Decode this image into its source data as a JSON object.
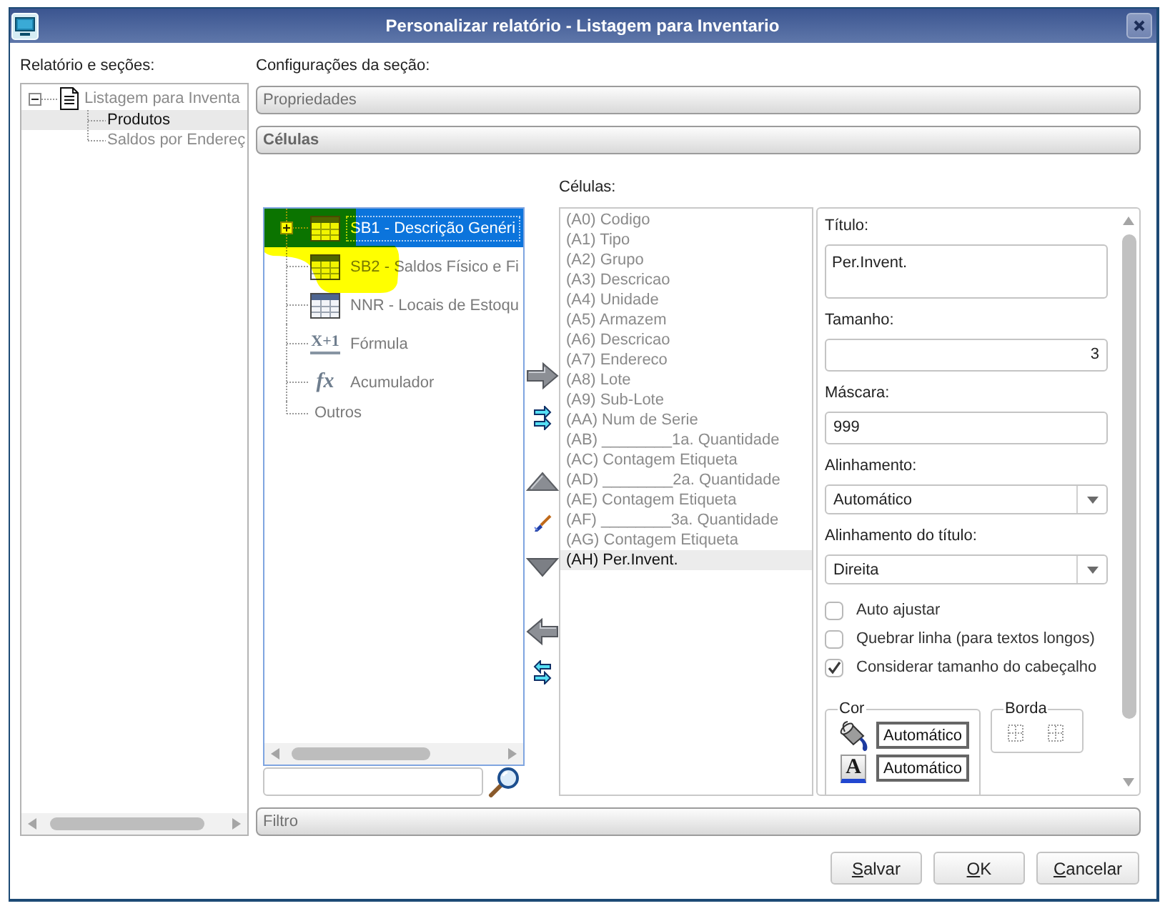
{
  "window": {
    "title": "Personalizar relatório - Listagem para Inventario"
  },
  "report_tree": {
    "label": "Relatório e seções:",
    "items": [
      {
        "label": "Listagem para Inventa",
        "kind": "document",
        "expanded": true,
        "selected": false,
        "children": [
          {
            "label": "Produtos",
            "selected": true
          },
          {
            "label": "Saldos por Endereç",
            "selected": false
          }
        ]
      }
    ]
  },
  "section": {
    "label": "Configurações da seção:",
    "panels": [
      {
        "label": "Propriedades",
        "expanded": false
      },
      {
        "label": "Células",
        "expanded": true,
        "editor": {
          "sources": [
            {
              "label": "SB1 - Descrição Genéri",
              "kind": "table",
              "collapsed": true,
              "selected": true
            },
            {
              "label": "SB2 - Saldos Físico e Fi",
              "kind": "table",
              "selected": false
            },
            {
              "label": "NNR - Locais de Estoqu",
              "kind": "table",
              "selected": false
            },
            {
              "label": "Fórmula",
              "kind": "formula",
              "glyph": "X+1",
              "selected": false
            },
            {
              "label": "Acumulador",
              "kind": "accumulator",
              "glyph": "fx",
              "selected": false
            },
            {
              "label": "Outros",
              "kind": "group",
              "selected": false
            }
          ],
          "cells": {
            "label": "Células:",
            "items": [
              {
                "label": "(A0) Codigo",
                "selected": false
              },
              {
                "label": "(A1) Tipo",
                "selected": false
              },
              {
                "label": "(A2) Grupo",
                "selected": false
              },
              {
                "label": "(A3) Descricao",
                "selected": false
              },
              {
                "label": "(A4) Unidade",
                "selected": false
              },
              {
                "label": "(A5) Armazem",
                "selected": false
              },
              {
                "label": "(A6) Descricao",
                "selected": false
              },
              {
                "label": "(A7) Endereco",
                "selected": false
              },
              {
                "label": "(A8) Lote",
                "selected": false
              },
              {
                "label": "(A9) Sub-Lote",
                "selected": false
              },
              {
                "label": "(AA) Num de Serie",
                "selected": false
              },
              {
                "label": "(AB) ________1a. Quantidade",
                "selected": false
              },
              {
                "label": "(AC) Contagem Etiqueta",
                "selected": false
              },
              {
                "label": "(AD) ________2a. Quantidade",
                "selected": false
              },
              {
                "label": "(AE) Contagem Etiqueta",
                "selected": false
              },
              {
                "label": "(AF) ________3a. Quantidade",
                "selected": false
              },
              {
                "label": "(AG) Contagem Etiqueta",
                "selected": false
              },
              {
                "label": "(AH) Per.Invent.",
                "selected": true
              }
            ]
          },
          "properties": {
            "fields": [
              {
                "kind": "textarea",
                "label": "Título:",
                "value": "Per.Invent."
              },
              {
                "kind": "number",
                "label": "Tamanho:",
                "value": "3"
              },
              {
                "kind": "text",
                "label": "Máscara:",
                "value": "999"
              },
              {
                "kind": "select",
                "label": "Alinhamento:",
                "value": "Automático"
              },
              {
                "kind": "select",
                "label": "Alinhamento do título:",
                "value": "Direita"
              }
            ],
            "options": [
              {
                "label": "Auto ajustar",
                "checked": false
              },
              {
                "label": "Quebrar linha (para textos longos)",
                "checked": false
              },
              {
                "label": "Considerar tamanho do cabeçalho",
                "checked": true
              }
            ],
            "color": {
              "label": "Cor",
              "items": [
                {
                  "kind": "fill",
                  "value": "Automático"
                },
                {
                  "kind": "font",
                  "glyph": "A",
                  "value": "Automático"
                }
              ]
            },
            "border": {
              "label": "Borda"
            }
          }
        }
      },
      {
        "label": "Filtro",
        "expanded": false
      }
    ]
  },
  "buttons": [
    "Salvar",
    "OK",
    "Cancelar"
  ]
}
